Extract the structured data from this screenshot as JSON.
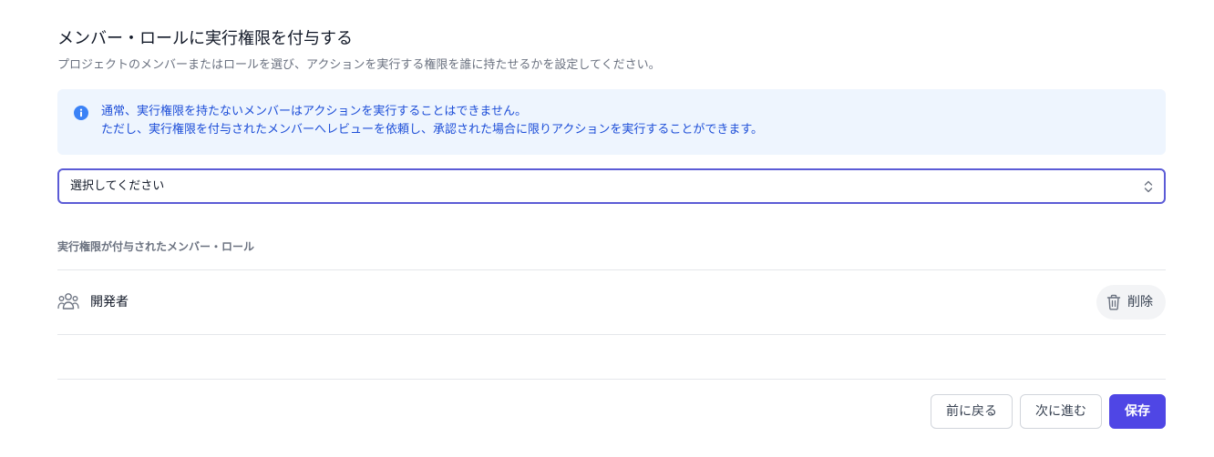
{
  "header": {
    "title": "メンバー・ロールに実行権限を付与する",
    "subtitle": "プロジェクトのメンバーまたはロールを選び、アクションを実行する権限を誰に持たせるかを設定してください。"
  },
  "info": {
    "icon": "info-icon",
    "color": "#1d4ed8",
    "background": "#eef5fe",
    "line1": "通常、実行権限を持たないメンバーはアクションを実行することはできません。",
    "line2": "ただし、実行権限を付与されたメンバーへレビューを依頼し、承認された場合に限りアクションを実行することができます。"
  },
  "select": {
    "value": "選択してください",
    "icon": "chevron-up-down-icon",
    "border_color": "#5b5bd6"
  },
  "granted": {
    "section_label": "実行権限が付与されたメンバー・ロール",
    "items": [
      {
        "icon": "user-group-icon",
        "label": "開発者",
        "delete_icon": "trash-icon",
        "delete_label": "削除"
      }
    ]
  },
  "footer": {
    "back_label": "前に戻る",
    "next_label": "次に進む",
    "save_label": "保存",
    "primary_color": "#4f46e5"
  }
}
